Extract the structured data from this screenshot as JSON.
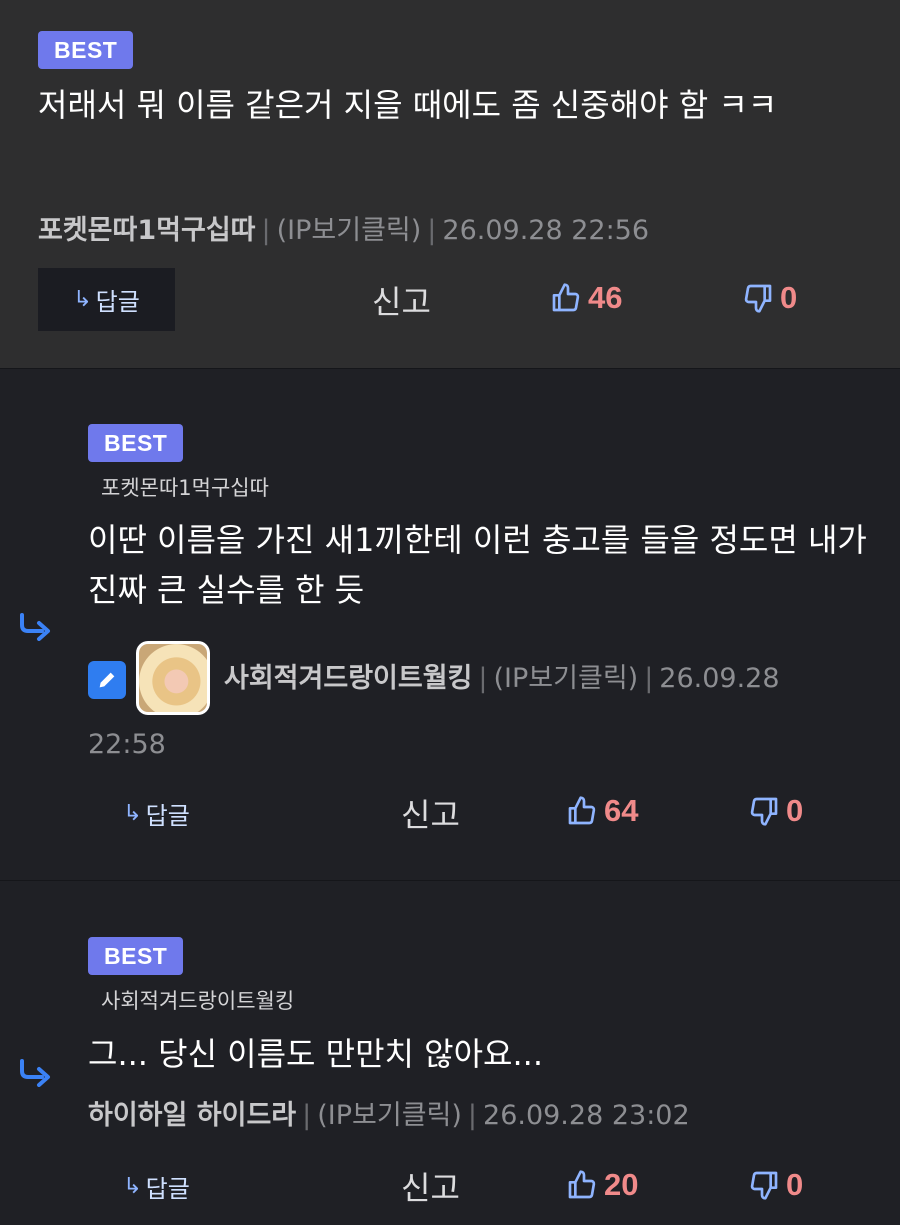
{
  "comments": [
    {
      "badge": "BEST",
      "text": "저래서 뭐 이름 같은거 지을 때에도 좀 신중해야 함 ㅋㅋ",
      "author": "포켓몬따1먹구십따",
      "ip": "(IP보기클릭)",
      "time": "26.09.28 22:56",
      "reply_label": "답글",
      "report_label": "신고",
      "likes": "46",
      "dislikes": "0"
    },
    {
      "badge": "BEST",
      "reply_to": "포켓몬따1먹구십따",
      "text": "이딴 이름을 가진 새1끼한테 이런 충고를 들을 정도면 내가 진짜 큰 실수를 한 듯",
      "author": "사회적겨드랑이트월킹",
      "ip": "(IP보기클릭)",
      "time_date": "26.09.28",
      "time_clock": "22:58",
      "reply_label": "답글",
      "report_label": "신고",
      "likes": "64",
      "dislikes": "0"
    },
    {
      "badge": "BEST",
      "reply_to": "사회적겨드랑이트월킹",
      "text": "그... 당신 이름도 만만치 않아요...",
      "author": "하이하일 하이드라",
      "ip": "(IP보기클릭)",
      "time": "26.09.28 23:02",
      "reply_label": "답글",
      "report_label": "신고",
      "likes": "20",
      "dislikes": "0"
    }
  ],
  "icons": {
    "reply_arrow": "reply-arrow-icon",
    "thumbs_up": "thumbs-up-icon",
    "thumbs_down": "thumbs-down-icon",
    "edit": "pencil-icon"
  },
  "colors": {
    "badge": "#6f79ec",
    "vote_count": "#f08a8a",
    "icon_blue": "#8fb4ff"
  }
}
